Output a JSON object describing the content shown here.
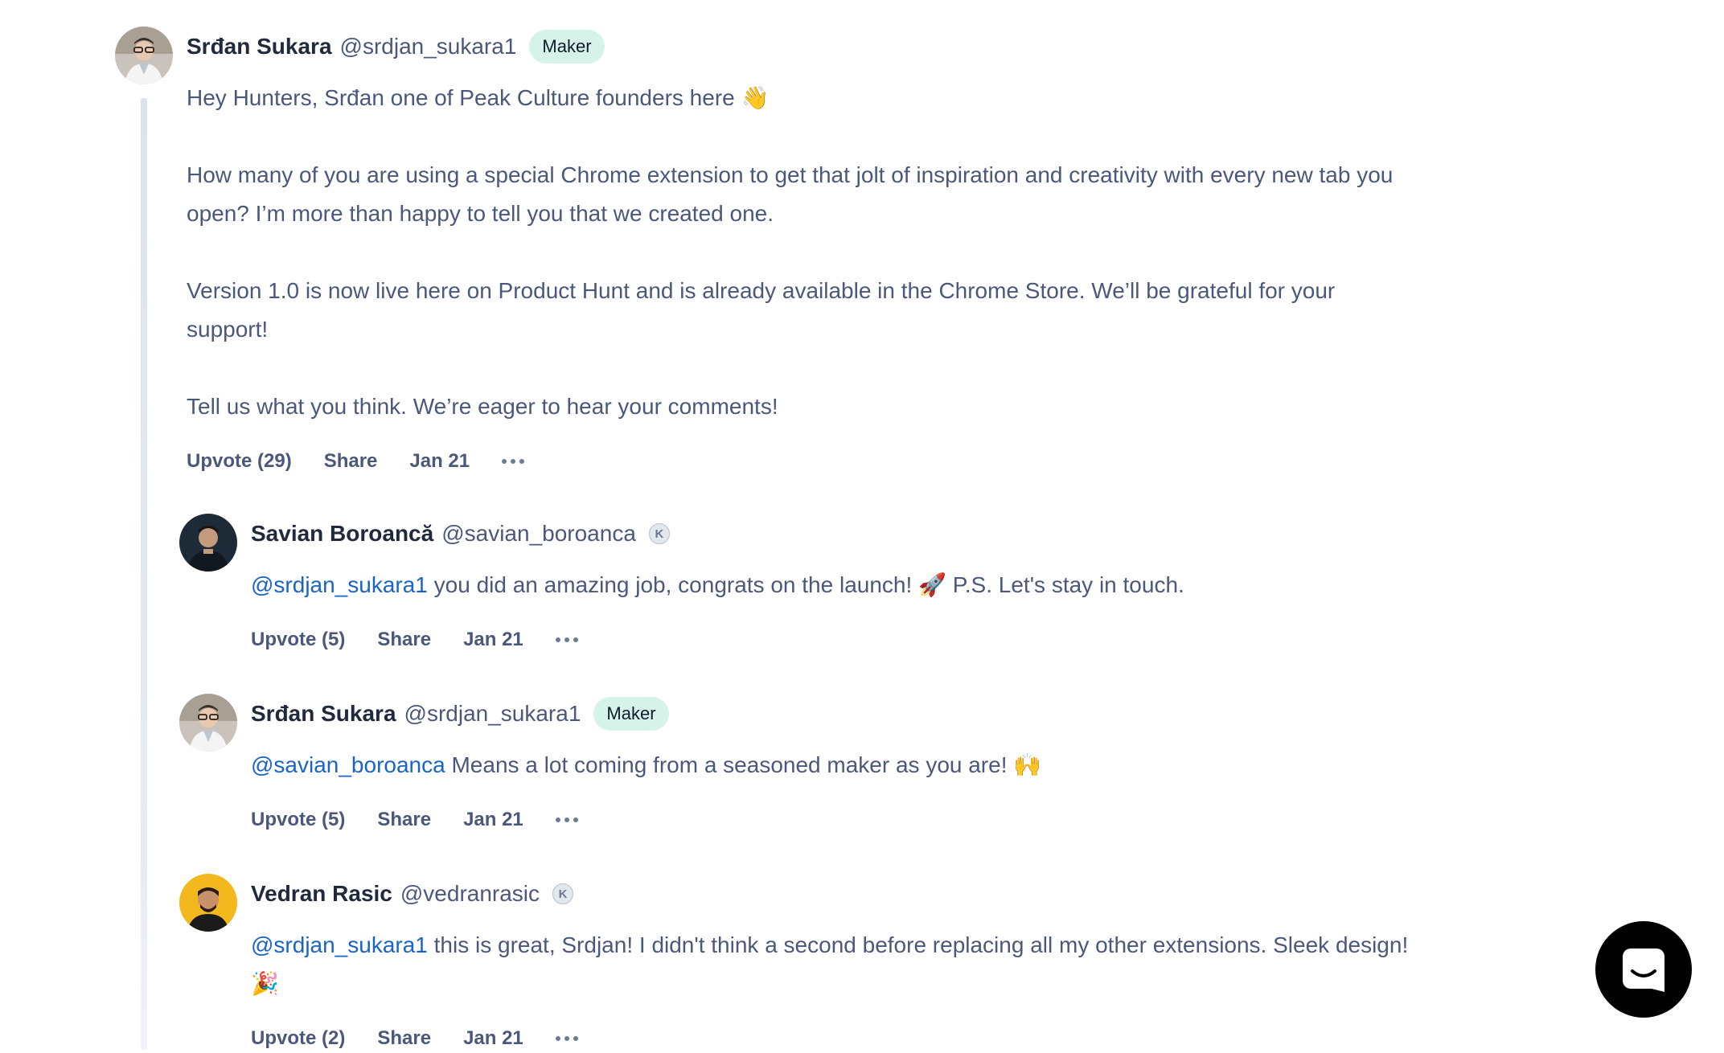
{
  "comments": [
    {
      "name": "Srđan Sukara",
      "handle": "@srdjan_sukara1",
      "badge": "Maker",
      "body": [
        "Hey Hunters, Srđan one of Peak Culture founders here 👋",
        "How many of you are using a special Chrome extension to get that jolt of inspiration and creativity with every new tab you open? I’m more than happy to tell you that we created one.",
        "Version 1.0 is now live here on Product Hunt and is already available in the Chrome Store. We’ll be grateful for your support!",
        "Tell us what you think. We’re eager to hear your comments!"
      ],
      "upvote": "Upvote",
      "upvote_count": "(29)",
      "share": "Share",
      "date": "Jan 21"
    },
    {
      "name": "Savian Boroancă",
      "handle": "@savian_boroanca",
      "karma": "K",
      "mention": "@srdjan_sukara1",
      "text": " you did an amazing job, congrats on the launch! 🚀 P.S. Let's stay in touch.",
      "upvote": "Upvote",
      "upvote_count": "(5)",
      "share": "Share",
      "date": "Jan 21"
    },
    {
      "name": "Srđan Sukara",
      "handle": "@srdjan_sukara1",
      "badge": "Maker",
      "mention": "@savian_boroanca",
      "text": " Means a lot coming from a seasoned maker as you are! 🙌",
      "upvote": "Upvote",
      "upvote_count": "(5)",
      "share": "Share",
      "date": "Jan 21"
    },
    {
      "name": "Vedran Rasic",
      "handle": "@vedranrasic",
      "karma": "K",
      "mention": "@srdjan_sukara1",
      "text": " this is great, Srdjan! I didn't think a second before replacing all my other extensions. Sleek design! 🎉",
      "upvote": "Upvote",
      "upvote_count": "(2)",
      "share": "Share",
      "date": "Jan 21"
    }
  ],
  "colors": {
    "name": "#21293c",
    "text": "#4b587c",
    "mention": "#1a64c8",
    "maker_badge_bg": "#d6f3e9",
    "chat_button": "#000000"
  },
  "icons": {
    "more": "more-horizontal-icon",
    "chat": "chat-bubble-icon"
  }
}
